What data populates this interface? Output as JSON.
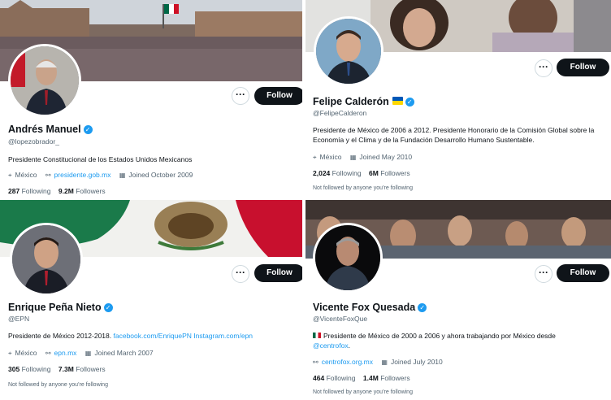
{
  "profiles": [
    {
      "name": "Andrés Manuel",
      "handle": "@lopezobrador_",
      "bio": "Presidente Constitucional de los Estados Unidos Mexicanos",
      "location": "México",
      "website": "presidente.gob.mx",
      "joined": "Joined October 2009",
      "following_count": "287",
      "following_label": "Following",
      "followers_count": "9.2M",
      "followers_label": "Followers",
      "follow_button": "Follow",
      "more_button": "···"
    },
    {
      "name": "Felipe Calderón",
      "handle": "@FelipeCalderon",
      "bio": "Presidente de México de 2006 a 2012. Presidente Honorario de la Comisión Global sobre la Economía y el Clima y de la Fundación Desarrollo Humano Sustentable.",
      "location": "México",
      "joined": "Joined May 2010",
      "following_count": "2,024",
      "following_label": "Following",
      "followers_count": "6M",
      "followers_label": "Followers",
      "not_followed": "Not followed by anyone you’re following",
      "follow_button": "Follow",
      "more_button": "···"
    },
    {
      "name": "Enrique Peña Nieto",
      "handle": "@EPN",
      "bio_text": "Presidente de México 2012-2018.",
      "bio_link1": "facebook.com/EnriquePN",
      "bio_link2": "Instagram.com/epn",
      "location": "México",
      "website": "epn.mx",
      "joined": "Joined March 2007",
      "following_count": "305",
      "following_label": "Following",
      "followers_count": "7.3M",
      "followers_label": "Followers",
      "not_followed": "Not followed by anyone you’re following",
      "follow_button": "Follow",
      "more_button": "···"
    },
    {
      "name": "Vicente Fox Quesada",
      "handle": "@VicenteFoxQue",
      "bio_text": "Presidente de México de 2000 a 2006 y ahora trabajando por México desde",
      "bio_link": "@centrofox",
      "bio_end": ".",
      "website": "centrofox.org.mx",
      "joined": "Joined July 2010",
      "following_count": "464",
      "following_label": "Following",
      "followers_count": "1.4M",
      "followers_label": "Followers",
      "not_followed": "Not followed by anyone you’re following",
      "follow_button": "Follow",
      "more_button": "···"
    }
  ],
  "colors": {
    "accent": "#1d9bf0",
    "button": "#0f1419",
    "muted": "#536471"
  }
}
